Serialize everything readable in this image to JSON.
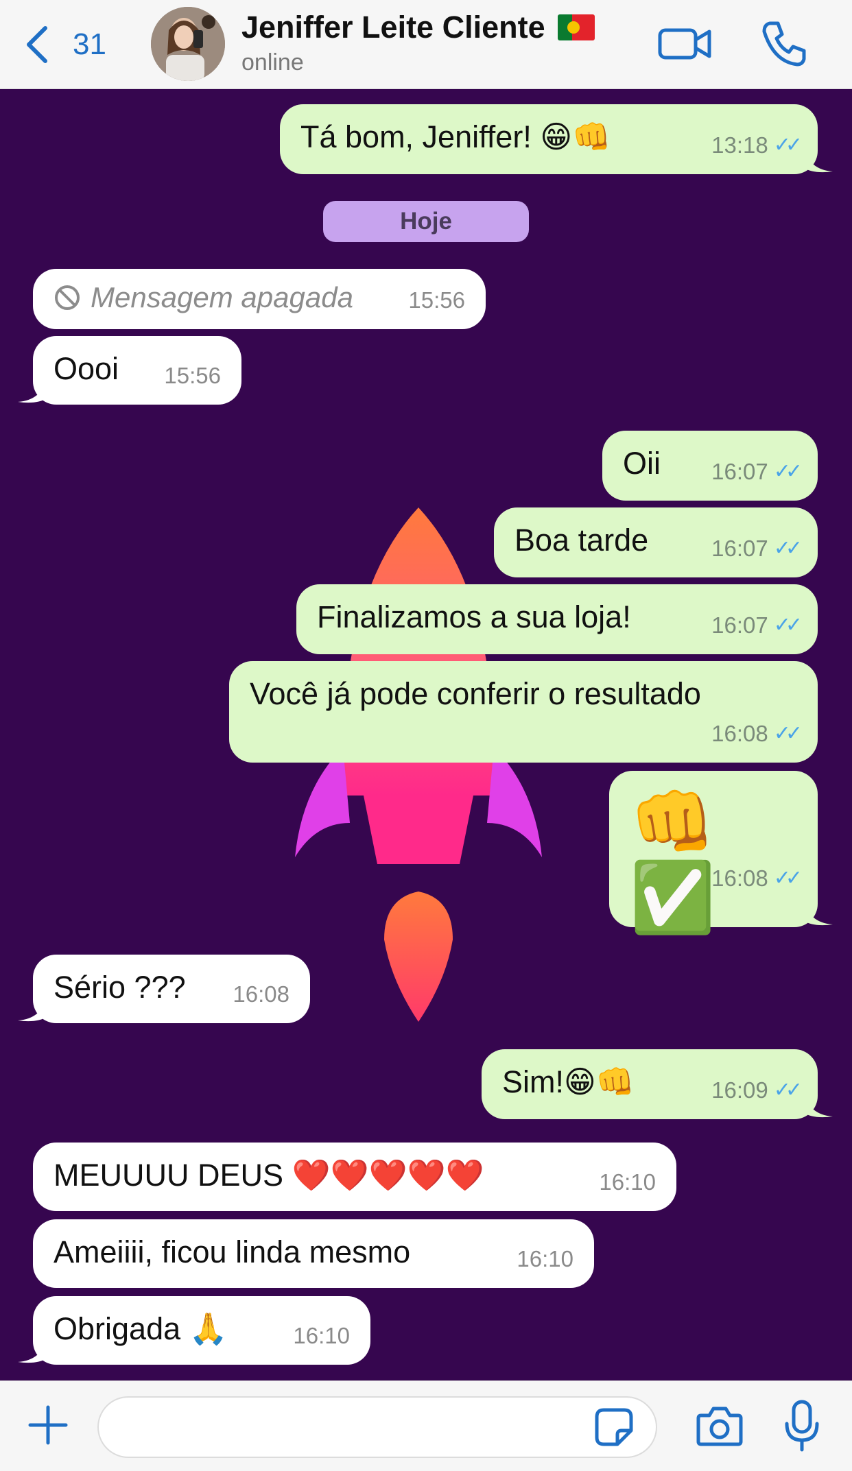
{
  "header": {
    "back_count": "31",
    "contact_name": "Jeniffer Leite Cliente",
    "status": "online",
    "flag_icon": "portugal-flag-icon"
  },
  "chat": {
    "date_separator": "Hoje",
    "messages": [
      {
        "dir": "out",
        "text": "Tá bom, Jeniffer! 😁👊",
        "time": "13:18"
      },
      {
        "dir": "in",
        "text": "Mensagem apagada",
        "time": "15:56",
        "deleted": true
      },
      {
        "dir": "in",
        "text": "Oooi",
        "time": "15:56"
      },
      {
        "dir": "out",
        "text": "Oii",
        "time": "16:07"
      },
      {
        "dir": "out",
        "text": "Boa tarde",
        "time": "16:07"
      },
      {
        "dir": "out",
        "text": "Finalizamos a sua loja!",
        "time": "16:07"
      },
      {
        "dir": "out",
        "text": "Você já pode conferir o resultado",
        "time": "16:08"
      },
      {
        "dir": "out",
        "text": "👊✅",
        "time": "16:08"
      },
      {
        "dir": "in",
        "text": "Sério ???",
        "time": "16:08"
      },
      {
        "dir": "out",
        "text": "Sim!😁👊",
        "time": "16:09"
      },
      {
        "dir": "in",
        "text": "MEUUUU DEUS ❤️❤️❤️❤️❤️",
        "time": "16:10"
      },
      {
        "dir": "in",
        "text": "Ameiiii, ficou linda mesmo",
        "time": "16:10"
      },
      {
        "dir": "in",
        "text": "Obrigada 🙏",
        "time": "16:10"
      }
    ],
    "read_ticks": "✓✓"
  },
  "input": {
    "placeholder": ""
  },
  "colors": {
    "chat_bg": "#36064f",
    "out_bubble": "#ddf8c8",
    "in_bubble": "#ffffff",
    "accent": "#1f6fc5",
    "date_chip": "#c7a3ee"
  }
}
